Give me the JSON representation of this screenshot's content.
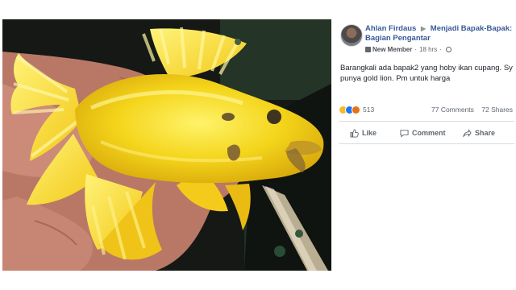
{
  "post": {
    "author": "Ahlan Firdaus",
    "group": "Menjadi Bapak-Bapak: Bagian Pengantar",
    "badge": "New Member",
    "time": "18 hrs",
    "text": "Barangkali ada bapak2 yang hoby ikan cupang. Sy punya gold lion. Pm untuk harga",
    "photo_subject": "yellow gold lion betta fish held in hand"
  },
  "stats": {
    "reactions": "513",
    "comments": "77 Comments",
    "shares": "72 Shares"
  },
  "actions": {
    "like": "Like",
    "comment": "Comment",
    "share": "Share"
  },
  "colors": {
    "link": "#385898",
    "meta": "#606770",
    "fish": "#f6d21c",
    "background": "#ffffff"
  },
  "icons": [
    "avatar",
    "member-icon",
    "globe-icon",
    "haha-reaction-icon",
    "like-reaction-icon",
    "angry-reaction-icon",
    "thumbs-up-icon",
    "comment-icon",
    "share-icon"
  ]
}
